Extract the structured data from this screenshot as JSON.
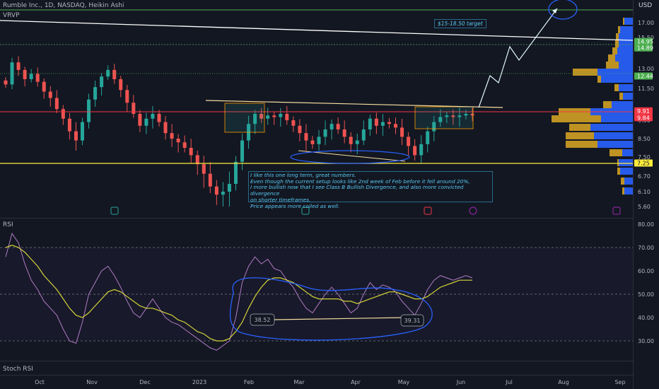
{
  "header": {
    "title": "Rumble Inc., 1D, NASDAQ, Heikin Ashi",
    "currency": "USD",
    "indicator": "VRVP"
  },
  "panes": {
    "rsi_label": "RSI",
    "stoch_label": "Stoch RSI"
  },
  "annotation": {
    "note_lines": [
      "I like this one long term, great numbers.",
      "Even though the current setup looks like 2nd week of Feb before it fell around 20%,",
      " I more bullish now that I see Class B Bullish Divergence, and also more convicted divergence",
      "on shorter timeframes.",
      "Price appears more coiled as well."
    ],
    "target_label": "$15-18.50 target"
  },
  "colors": {
    "up": "#26a69a",
    "down": "#ef5350",
    "rsi": "#b07cc6",
    "rsi_ma": "#d4d43a",
    "annotation": "#2962ff",
    "profile_up": "#2962ff",
    "profile_down": "#d1a023"
  },
  "chart_data": [
    {
      "type": "candlestick",
      "title": "Rumble Inc., 1D, NASDAQ, Heikin Ashi",
      "x_ticks": [
        "Oct",
        "Nov",
        "Dec",
        "2023",
        "Feb",
        "Mar",
        "Apr",
        "May",
        "Jun",
        "Jul",
        "Aug",
        "Sep"
      ],
      "y_ticks": [
        17.0,
        15.5,
        13.0,
        11.5,
        9.5,
        8.5,
        7.5,
        6.7,
        6.1,
        5.6
      ],
      "ylim": [
        5.6,
        18.5
      ],
      "price_labels": [
        {
          "value": "14.95",
          "color": "#4caf50"
        },
        {
          "value": "14.89",
          "color": "#4caf50"
        },
        {
          "value": "12.44",
          "color": "#4caf50"
        },
        {
          "value": "9.91",
          "color": "#f23645"
        },
        {
          "value": "9.84",
          "color": "#f23645"
        },
        {
          "value": "7.25",
          "color": "#ffeb3b"
        }
      ],
      "series": [
        {
          "name": "close",
          "values": [
            11.8,
            13.5,
            12.9,
            12.2,
            12.6,
            12.0,
            11.3,
            10.9,
            10.2,
            9.6,
            8.9,
            8.4,
            9.4,
            10.8,
            11.6,
            12.4,
            12.9,
            12.2,
            11.4,
            10.6,
            9.9,
            9.2,
            9.6,
            9.9,
            9.4,
            8.8,
            8.5,
            8.3,
            8.0,
            7.6,
            7.2,
            6.8,
            6.3,
            6.0,
            6.1,
            6.4,
            7.3,
            8.4,
            9.3,
            9.9,
            9.6,
            9.8,
            9.7,
            9.9,
            9.5,
            9.2,
            8.8,
            8.4,
            8.2,
            8.6,
            9.0,
            9.3,
            9.0,
            8.6,
            8.2,
            8.4,
            9.0,
            9.6,
            9.2,
            9.4,
            9.3,
            9.1,
            8.6,
            8.1,
            7.6,
            8.2,
            8.9,
            9.4,
            9.7,
            9.8,
            9.7,
            9.8,
            9.9,
            9.8
          ]
        }
      ]
    },
    {
      "type": "line",
      "title": "RSI",
      "y_ticks": [
        80.0,
        70.0,
        60.0,
        50.0,
        40.0,
        30.0
      ],
      "ylim": [
        23,
        81
      ],
      "series": [
        {
          "name": "RSI",
          "values": [
            66,
            76,
            72,
            63,
            56,
            52,
            47,
            44,
            41,
            35,
            30,
            29,
            38,
            50,
            55,
            60,
            62,
            58,
            53,
            47,
            42,
            40,
            44,
            48,
            44,
            40,
            38,
            37,
            35,
            33,
            31,
            29,
            27,
            26,
            28,
            30,
            40,
            55,
            62,
            66,
            63,
            65,
            61,
            60,
            56,
            53,
            48,
            44,
            42,
            46,
            50,
            53,
            50,
            46,
            42,
            44,
            50,
            55,
            52,
            54,
            53,
            51,
            47,
            44,
            41,
            46,
            52,
            56,
            58,
            57,
            56,
            57,
            58,
            57
          ]
        },
        {
          "name": "RSI MA",
          "values": [
            70,
            71,
            70,
            68,
            65,
            62,
            58,
            55,
            52,
            48,
            44,
            41,
            40,
            42,
            45,
            48,
            51,
            52,
            51,
            49,
            47,
            45,
            44,
            44,
            43,
            42,
            41,
            39,
            38,
            36,
            34,
            33,
            31,
            30,
            30,
            31,
            34,
            38,
            44,
            49,
            53,
            56,
            57,
            57,
            56,
            55,
            53,
            51,
            49,
            48,
            48,
            48,
            48,
            47,
            47,
            46,
            47,
            48,
            49,
            50,
            51,
            51,
            50,
            49,
            48,
            48,
            49,
            51,
            53,
            54,
            55,
            56,
            56,
            56
          ]
        }
      ],
      "annotations": [
        {
          "value": "38.52"
        },
        {
          "value": "39.31"
        }
      ]
    }
  ]
}
